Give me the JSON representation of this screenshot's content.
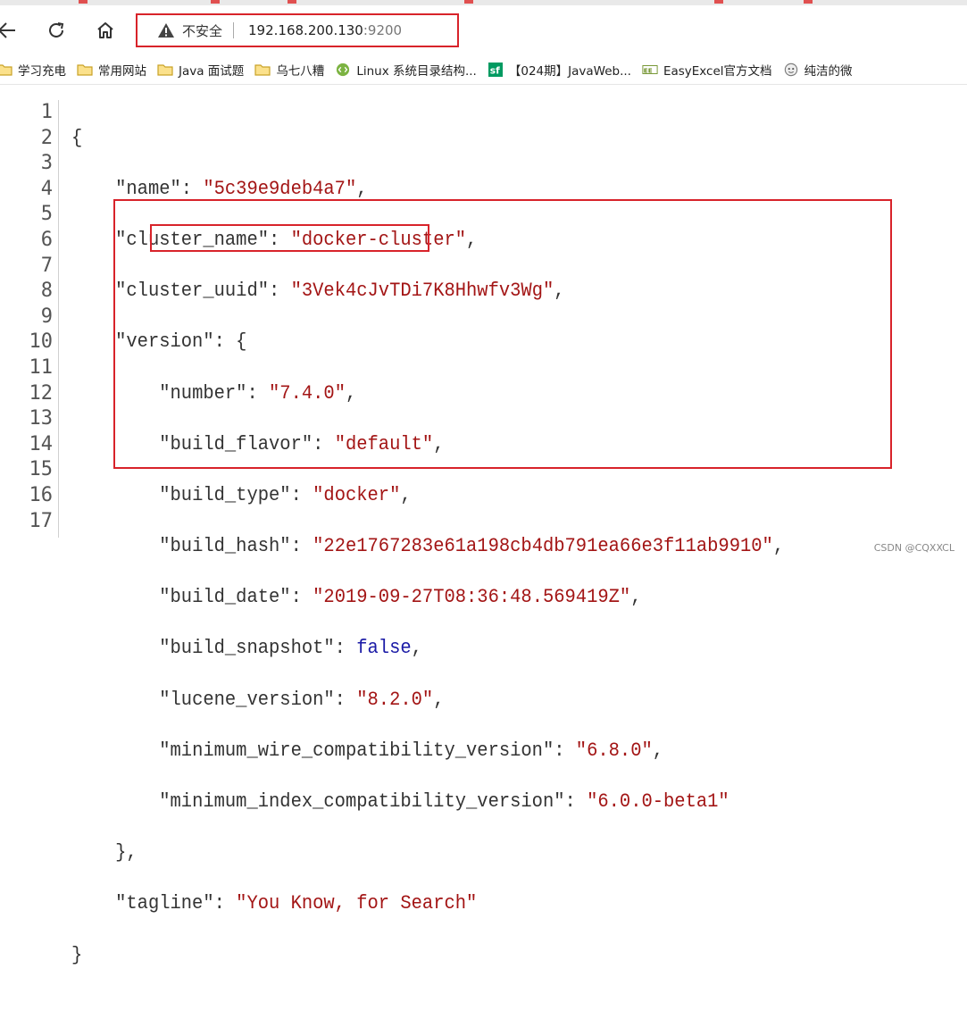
{
  "browser": {
    "security_label": "不安全",
    "url_host": "192.168.200.130",
    "url_port": ":9200"
  },
  "bookmarks": [
    {
      "label": "学习充电",
      "icon": "folder-icon"
    },
    {
      "label": "常用网站",
      "icon": "folder-icon"
    },
    {
      "label": "Java 面试题",
      "icon": "folder-icon"
    },
    {
      "label": "乌七八糟",
      "icon": "folder-icon"
    },
    {
      "label": "Linux 系统目录结构...",
      "icon": "code-icon"
    },
    {
      "label": "【024期】JavaWeb...",
      "icon": "sf-icon"
    },
    {
      "label": "EasyExcel官方文档",
      "icon": "easyexcel-icon"
    },
    {
      "label": "纯洁的微",
      "icon": "site-icon"
    }
  ],
  "json_doc": {
    "line_numbers": [
      "1",
      "2",
      "3",
      "4",
      "5",
      "6",
      "7",
      "8",
      "9",
      "10",
      "11",
      "12",
      "13",
      "14",
      "15",
      "16",
      "17"
    ],
    "open_brace": "{",
    "close_brace": "}",
    "name_key": "\"name\"",
    "name_val": "\"5c39e9deb4a7\"",
    "cluster_name_key": "\"cluster_name\"",
    "cluster_name_val": "\"docker-cluster\"",
    "cluster_uuid_key": "\"cluster_uuid\"",
    "cluster_uuid_val": "\"3Vek4cJvTDi7K8Hhwfv3Wg\"",
    "version_key": "\"version\"",
    "version_open": "{",
    "version_close": "},",
    "number_key": "\"number\"",
    "number_val": "\"7.4.0\"",
    "build_flavor_key": "\"build_flavor\"",
    "build_flavor_val": "\"default\"",
    "build_type_key": "\"build_type\"",
    "build_type_val": "\"docker\"",
    "build_hash_key": "\"build_hash\"",
    "build_hash_val": "\"22e1767283e61a198cb4db791ea66e3f11ab9910\"",
    "build_date_key": "\"build_date\"",
    "build_date_val": "\"2019-09-27T08:36:48.569419Z\"",
    "build_snapshot_key": "\"build_snapshot\"",
    "build_snapshot_val": "false",
    "lucene_version_key": "\"lucene_version\"",
    "lucene_version_val": "\"8.2.0\"",
    "min_wire_key": "\"minimum_wire_compatibility_version\"",
    "min_wire_val": "\"6.8.0\"",
    "min_index_key": "\"minimum_index_compatibility_version\"",
    "min_index_val": "\"6.0.0-beta1\"",
    "tagline_key": "\"tagline\"",
    "tagline_val": "\"You Know, for Search\""
  },
  "watermark": "CSDN @CQXXCL",
  "colors": {
    "highlight_box": "#d8232a",
    "string": "#a31515",
    "boolean": "#1a1aa6"
  }
}
